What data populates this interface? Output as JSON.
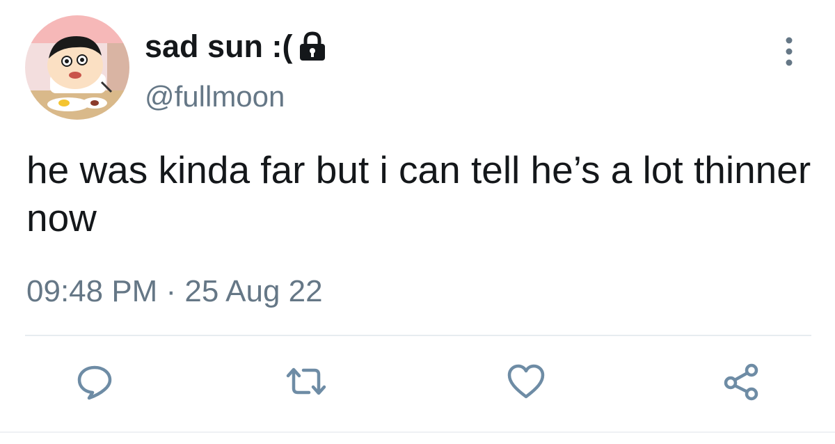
{
  "user": {
    "display_name": "sad sun :(",
    "handle": "@fullmoon",
    "protected": true,
    "avatar_icon": "cartoon-boy-eating-avatar"
  },
  "tweet": {
    "text": "he was kinda far but i can tell he’s a lot thinner now",
    "timestamp": "09:48 PM · 25 Aug 22"
  },
  "actions": [
    {
      "name": "reply",
      "icon": "speech-bubble-icon"
    },
    {
      "name": "retweet",
      "icon": "retweet-icon"
    },
    {
      "name": "like",
      "icon": "heart-icon"
    },
    {
      "name": "share",
      "icon": "share-icon"
    }
  ],
  "colors": {
    "text": "#14171a",
    "secondary": "#657786",
    "icon": "#6e8ca5",
    "divider": "#e6ecf0"
  }
}
